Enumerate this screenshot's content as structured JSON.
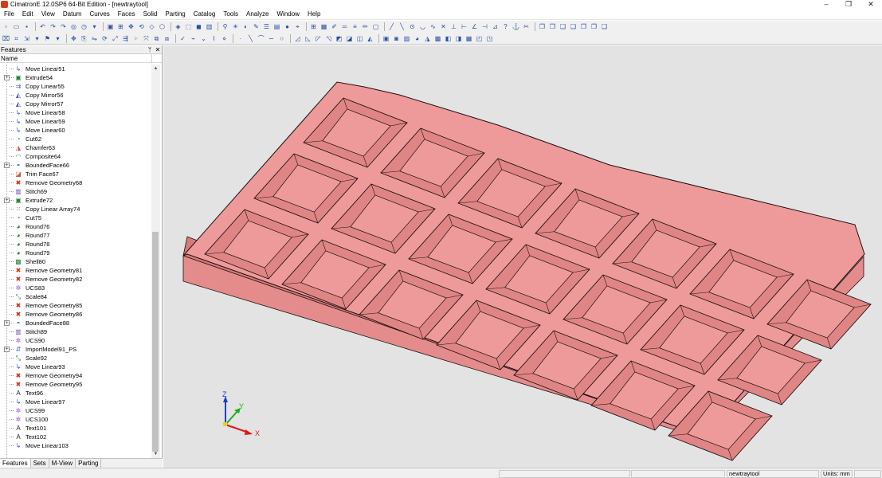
{
  "window": {
    "title": "CimatronE 12.0SP6  64-Bit Edition - [newtraytool]",
    "controls": [
      "‒",
      "❐",
      "✕"
    ]
  },
  "menu": [
    "File",
    "Edit",
    "View",
    "Datum",
    "Curves",
    "Faces",
    "Solid",
    "Parting",
    "Catalog",
    "Tools",
    "Analyze",
    "Window",
    "Help"
  ],
  "panel": {
    "title": "Features",
    "column_header": "Name",
    "pin": "ᛘ",
    "close": "✕",
    "tabs": [
      "Features",
      "Sets",
      "M-View",
      "Parting"
    ],
    "items": [
      {
        "label": "Move Linear51",
        "icon": "move-linear-icon",
        "expander": ""
      },
      {
        "label": "Extrude54",
        "icon": "extrude-icon",
        "expander": "+"
      },
      {
        "label": "Copy Linear55",
        "icon": "copy-linear-icon",
        "expander": ""
      },
      {
        "label": "Copy Mirror56",
        "icon": "copy-mirror-icon",
        "expander": ""
      },
      {
        "label": "Copy Mirror57",
        "icon": "copy-mirror-icon",
        "expander": ""
      },
      {
        "label": "Move Linear58",
        "icon": "move-linear-icon",
        "expander": ""
      },
      {
        "label": "Move Linear59",
        "icon": "move-linear-icon",
        "expander": ""
      },
      {
        "label": "Move Linear60",
        "icon": "move-linear-icon",
        "expander": ""
      },
      {
        "label": "Cut62",
        "icon": "cut-icon",
        "expander": ""
      },
      {
        "label": "Chamfer63",
        "icon": "chamfer-icon",
        "expander": ""
      },
      {
        "label": "Composite64",
        "icon": "composite-icon",
        "expander": ""
      },
      {
        "label": "BoundedFace66",
        "icon": "bounded-face-icon",
        "expander": "+"
      },
      {
        "label": "Trim Face67",
        "icon": "trim-face-icon",
        "expander": ""
      },
      {
        "label": "Remove Geometry68",
        "icon": "remove-geometry-icon",
        "expander": ""
      },
      {
        "label": "Stitch69",
        "icon": "stitch-icon",
        "expander": ""
      },
      {
        "label": "Extrude72",
        "icon": "extrude-icon",
        "expander": "+"
      },
      {
        "label": "Copy Linear Array74",
        "icon": "linear-array-icon",
        "expander": ""
      },
      {
        "label": "Cut75",
        "icon": "cut-icon",
        "expander": ""
      },
      {
        "label": "Round76",
        "icon": "round-icon",
        "expander": ""
      },
      {
        "label": "Round77",
        "icon": "round-icon",
        "expander": ""
      },
      {
        "label": "Round78",
        "icon": "round-icon",
        "expander": ""
      },
      {
        "label": "Round79",
        "icon": "round-icon",
        "expander": ""
      },
      {
        "label": "Shell80",
        "icon": "shell-icon",
        "expander": ""
      },
      {
        "label": "Remove Geometry81",
        "icon": "remove-geometry-icon",
        "expander": ""
      },
      {
        "label": "Remove Geometry82",
        "icon": "remove-geometry-icon",
        "expander": ""
      },
      {
        "label": "UCS83",
        "icon": "ucs-icon",
        "expander": ""
      },
      {
        "label": "Scale84",
        "icon": "scale-icon",
        "expander": ""
      },
      {
        "label": "Remove Geometry85",
        "icon": "remove-geometry-icon",
        "expander": ""
      },
      {
        "label": "Remove Geometry86",
        "icon": "remove-geometry-icon",
        "expander": ""
      },
      {
        "label": "BoundedFace88",
        "icon": "bounded-face-icon",
        "expander": "+"
      },
      {
        "label": "Stitch89",
        "icon": "stitch-icon",
        "expander": ""
      },
      {
        "label": "UCS90",
        "icon": "ucs-icon",
        "expander": ""
      },
      {
        "label": "ImportModel91_PS",
        "icon": "import-model-icon",
        "expander": "+"
      },
      {
        "label": "Scale92",
        "icon": "scale-icon",
        "expander": ""
      },
      {
        "label": "Move Linear93",
        "icon": "move-linear-icon",
        "expander": ""
      },
      {
        "label": "Remove Geometry94",
        "icon": "remove-geometry-icon",
        "expander": ""
      },
      {
        "label": "Remove Geometry95",
        "icon": "remove-geometry-icon",
        "expander": ""
      },
      {
        "label": "Text96",
        "icon": "text-icon",
        "expander": ""
      },
      {
        "label": "Move Linear97",
        "icon": "move-linear-icon",
        "expander": ""
      },
      {
        "label": "UCS99",
        "icon": "ucs-icon",
        "expander": ""
      },
      {
        "label": "UCS100",
        "icon": "ucs-icon",
        "expander": ""
      },
      {
        "label": "Text101",
        "icon": "text-icon",
        "expander": ""
      },
      {
        "label": "Text102",
        "icon": "text-icon",
        "expander": ""
      },
      {
        "label": "Move Linear103",
        "icon": "move-linear-icon",
        "expander": ""
      }
    ]
  },
  "axes": {
    "x": "X",
    "y": "Y",
    "z": "Z"
  },
  "status": {
    "document": "newtraytool",
    "units": "Units: mm"
  },
  "colors": {
    "model_fill": "#ee9a9a",
    "model_edge": "#1f1010",
    "viewport_bg": "#e3e3e3"
  }
}
